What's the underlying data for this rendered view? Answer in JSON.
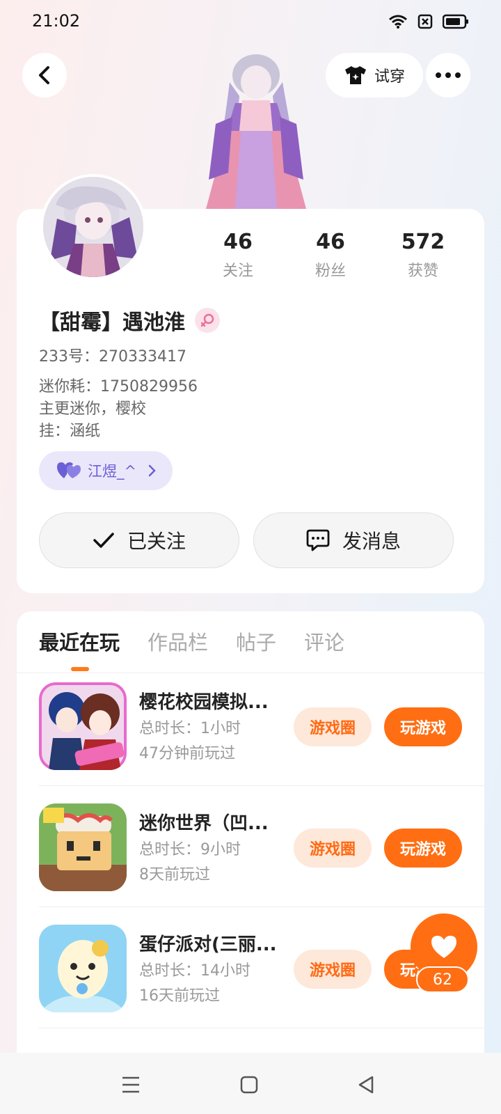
{
  "status_bar": {
    "time": "21:02"
  },
  "header": {
    "tryon_label": "试穿"
  },
  "stats": [
    {
      "value": "46",
      "label": "关注"
    },
    {
      "value": "46",
      "label": "粉丝"
    },
    {
      "value": "572",
      "label": "获赞"
    }
  ],
  "profile": {
    "nickname": "【甜霉】遇池淮",
    "uid": "233号：270333417",
    "bio": [
      "迷你耗：1750829956",
      "主更迷你，樱校",
      "挂：涵纸"
    ],
    "cp_tag": "江煜_^",
    "followed_label": "已关注",
    "message_label": "发消息"
  },
  "tabs": [
    "最近在玩",
    "作品栏",
    "帖子",
    "评论"
  ],
  "games": [
    {
      "name": "樱花校园模拟...",
      "time": "总时长：1小时",
      "last": "47分钟前玩过",
      "circle": "游戏圈",
      "play": "玩游戏"
    },
    {
      "name": "迷你世界（凹...",
      "time": "总时长：9小时",
      "last": "8天前玩过",
      "circle": "游戏圈",
      "play": "玩游戏"
    },
    {
      "name": "蛋仔派对(三丽...",
      "time": "总时长：14小时",
      "last": "16天前玩过",
      "circle": "游戏圈",
      "play": "玩游戏"
    }
  ],
  "like_count": "62",
  "colors": {
    "accent": "#ff6e12",
    "accent_light": "#fde8da",
    "cp_bg": "#ebe7fa",
    "cp_text": "#6b5fd6"
  }
}
